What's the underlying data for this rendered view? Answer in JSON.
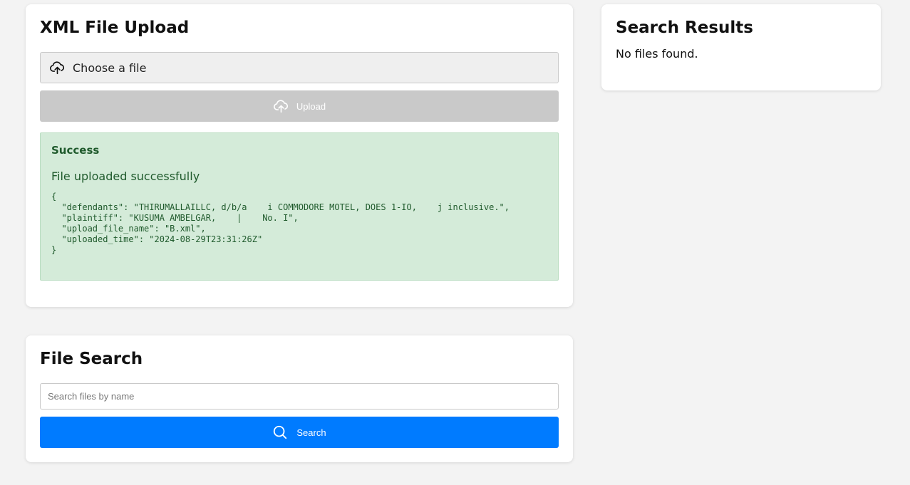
{
  "upload": {
    "title": "XML File Upload",
    "choose_label": "Choose a file",
    "upload_label": "Upload",
    "alert": {
      "title": "Success",
      "message": "File uploaded successfully",
      "json_text": "{\n  \"defendants\": \"THIRUMALLAILLC, d/b/a    i COMMODORE MOTEL, DOES 1-IO,    j inclusive.\",\n  \"plaintiff\": \"KUSUMA AMBELGAR,    |    No. I\",\n  \"upload_file_name\": \"B.xml\",\n  \"uploaded_time\": \"2024-08-29T23:31:26Z\"\n}"
    }
  },
  "search": {
    "title": "File Search",
    "placeholder": "Search files by name",
    "button_label": "Search"
  },
  "results": {
    "title": "Search Results",
    "empty_text": "No files found."
  },
  "colors": {
    "page_bg": "#f3f3f3",
    "primary": "#007bff",
    "disabled": "#c9c9c9",
    "success_bg": "#d4ebd9",
    "success_text": "#1f5a2c"
  },
  "icons": {
    "choose": "cloud-upload-icon",
    "upload": "cloud-upload-icon",
    "search": "search-icon"
  }
}
